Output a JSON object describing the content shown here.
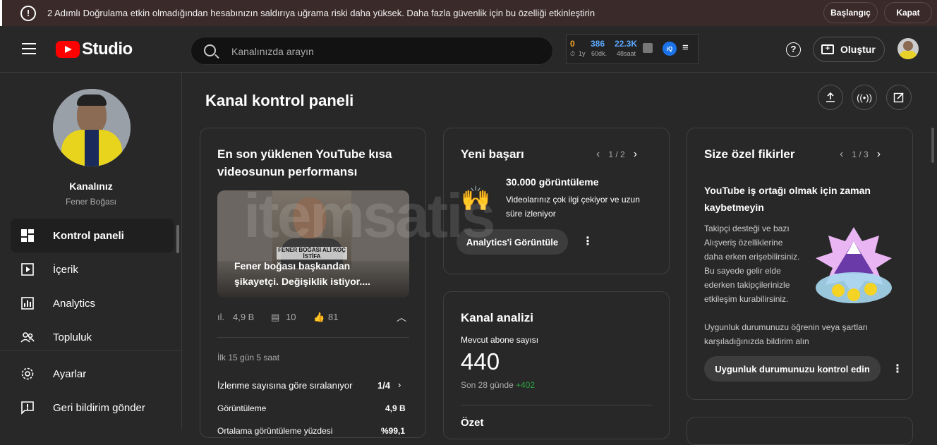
{
  "banner": {
    "icon": "warning-icon",
    "message": "2 Adımlı Doğrulama etkin olmadığından hesabınızın saldırıya uğrama riski daha yüksek. Daha fazla güvenlik için bu özelliği etkinleştirin",
    "start_label": "Başlangıç",
    "close_label": "Kapat"
  },
  "header": {
    "logo_text": "Studio",
    "search_placeholder": "Kanalınızda arayın",
    "ext": {
      "v1": "0",
      "l1": "1y",
      "v2": "386",
      "l2": "60dk.",
      "v3": "22.3K",
      "l3": "48saat",
      "badge": "iQ"
    },
    "create_label": "Oluştur"
  },
  "sidebar": {
    "channel_label": "Kanalınız",
    "channel_name": "Fener Boğası",
    "items": [
      {
        "label": "Kontrol paneli",
        "icon": "dashboard-icon"
      },
      {
        "label": "İçerik",
        "icon": "content-icon"
      },
      {
        "label": "Analytics",
        "icon": "analytics-icon"
      },
      {
        "label": "Topluluk",
        "icon": "community-icon"
      },
      {
        "label": "Ayarlar",
        "icon": "settings-icon"
      },
      {
        "label": "Geri bildirim gönder",
        "icon": "feedback-icon"
      }
    ]
  },
  "main": {
    "title": "Kanal kontrol paneli",
    "watermark": "itemsatis",
    "shorts_card": {
      "title": "En son yüklenen YouTube kısa videosunun performansı",
      "thumb_overlay": "FENER BOĞASI ALİ KOÇ İSTİFA",
      "video_title": "Fener boğası başkandan şikayetçi. Değişiklik istiyor....",
      "views": "4,9 B",
      "comments": "10",
      "likes": "81",
      "period": "İlk 15 gün 5 saat",
      "rank_label": "İzlenme sayısına göre sıralanıyor",
      "rank_value": "1/4",
      "row1_label": "Görüntüleme",
      "row1_value": "4,9 B",
      "row2_label": "Ortalama görüntüleme yüzdesi",
      "row2_value": "%99,1"
    },
    "achievement_card": {
      "title": "Yeni başarı",
      "pager": "1 / 2",
      "headline": "30.000 görüntüleme",
      "body": "Videolarınız çok ilgi çekiyor ve uzun süre izleniyor",
      "button_label": "Analytics'i Görüntüle"
    },
    "analytics_card": {
      "title": "Kanal analizi",
      "subs_label": "Mevcut abone sayısı",
      "subs_value": "440",
      "period_label": "Son 28 günde",
      "period_delta": "+402",
      "summary_label": "Özet"
    },
    "ideas_card": {
      "title": "Size özel fikirler",
      "pager": "1 / 3",
      "headline": "YouTube iş ortağı olmak için zaman kaybetmeyin",
      "body": "Takipçi desteği ve bazı Alışveriş özelliklerine daha erken erişebilirsiniz. Bu sayede gelir elde ederken takipçilerinizle etkileşim kurabilirsiniz.",
      "body2": "Uygunluk durumunuzu öğrenin veya şartları karşıladığınızda bildirim alın",
      "button_label": "Uygunluk durumunuzu kontrol edin"
    }
  },
  "colors": {
    "accent_green": "#2ba640",
    "brand_red": "#ff0000",
    "ext_orange": "#f5a623",
    "ext_blue": "#5aa9ff"
  }
}
